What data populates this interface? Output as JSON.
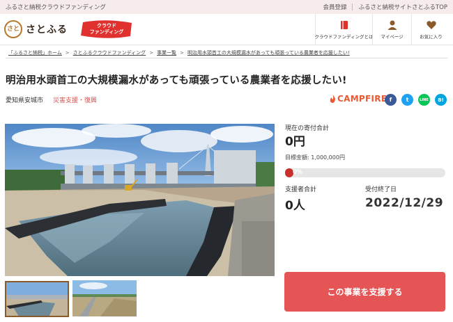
{
  "topbar": {
    "left": "ふるさと納税クラウドファンディング",
    "links": [
      "会員登録",
      "ふるさと納税サイトさとふるTOP"
    ]
  },
  "header": {
    "logo_mark": "さと",
    "logo_text": "さとふる",
    "badge_line1": "クラウド",
    "badge_line2": "ファンディング",
    "nav": [
      {
        "label": "クラウドファンディングとは",
        "icon": "book-icon"
      },
      {
        "label": "マイページ",
        "icon": "user-icon"
      },
      {
        "label": "お気に入り",
        "icon": "heart-icon"
      }
    ]
  },
  "breadcrumb": [
    "「ふるさと納税」ホーム",
    "さとふるクラウドファンディング",
    "事業一覧",
    "明治用水頭首工の大規模漏水があっても頑張っている農業者を応援したい!"
  ],
  "project": {
    "title": "明治用水頭首工の大規模漏水があっても頑張っている農業者を応援したい!",
    "location": "愛知県安城市",
    "category": "災害支援・復興",
    "platform": "CAMPFIRE",
    "share": [
      "f",
      "t",
      "LINE",
      "B!"
    ]
  },
  "stats": {
    "current_label": "現在の寄付合計",
    "current_value": "0円",
    "goal_text": "目標金額: 1,000,000円",
    "progress_percent": 0,
    "progress_text": "0%",
    "supporters_label": "支援者合計",
    "supporters_value": "0人",
    "end_label": "受付終了日",
    "end_value": "2022/12/29"
  },
  "cta": {
    "label": "この事業を支援する"
  },
  "colors": {
    "accent": "#e55555",
    "brand": "#b5792b",
    "campfire": "#e85a36"
  }
}
